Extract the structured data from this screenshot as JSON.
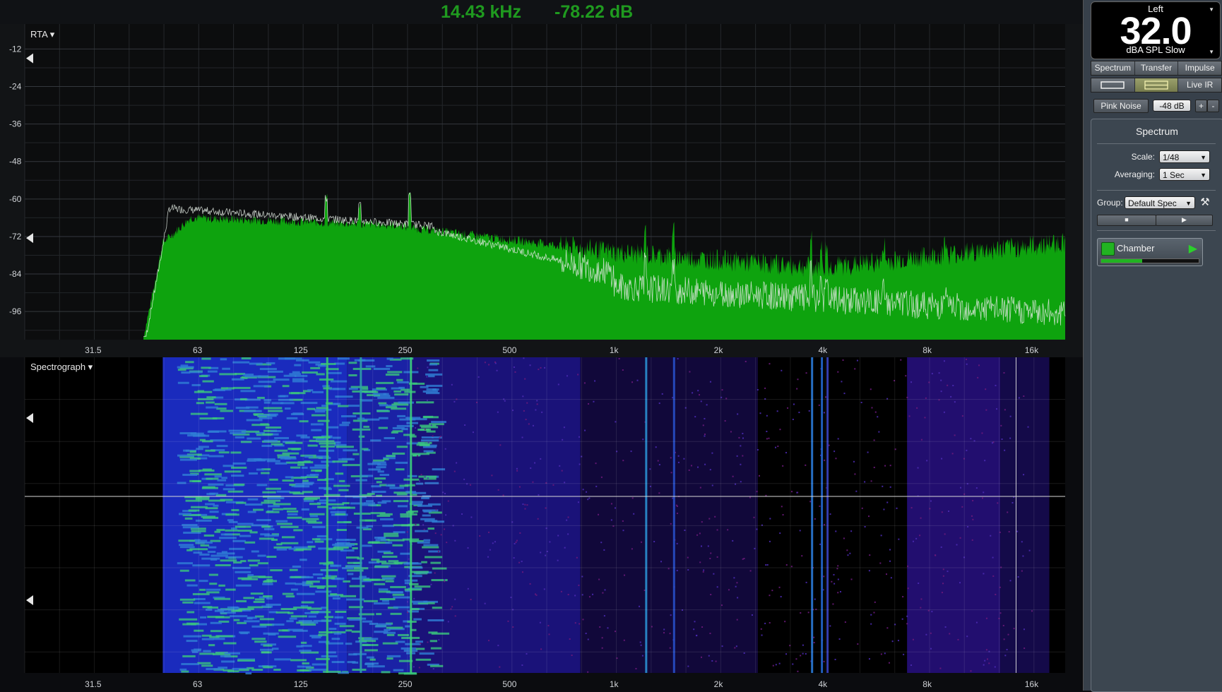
{
  "readout": {
    "frequency": "14.43 kHz",
    "level": "-78.22 dB",
    "color": "#1f9a1f"
  },
  "rta": {
    "menu_label": "RTA ▾",
    "y_ticks": [
      "-12",
      "-24",
      "-36",
      "-48",
      "-60",
      "-72",
      "-84",
      "-96"
    ],
    "x_ticks": [
      "31.5",
      "63",
      "125",
      "250",
      "500",
      "1k",
      "2k",
      "4k",
      "8k",
      "16k"
    ]
  },
  "spectrograph": {
    "menu_label": "Spectrograph ▾",
    "x_ticks": [
      "31.5",
      "63",
      "125",
      "250",
      "500",
      "1k",
      "2k",
      "4k",
      "8k",
      "16k"
    ]
  },
  "meter": {
    "channel": "Left",
    "value": "32.0",
    "unit": "dBA SPL Slow"
  },
  "tabs": [
    "Spectrum",
    "Transfer",
    "Impulse"
  ],
  "live_ir_label": "Live IR",
  "generator": {
    "label": "Pink Noise",
    "level": "-48 dB",
    "plus": "+",
    "minus": "-"
  },
  "spectrum_panel": {
    "title": "Spectrum",
    "scale_label": "Scale:",
    "scale_value": "1/48",
    "averaging_label": "Averaging:",
    "averaging_value": "1 Sec",
    "group_label": "Group:",
    "group_value": "Default Spec"
  },
  "measurement": {
    "name": "Chamber",
    "color": "#25b825"
  },
  "colors": {
    "trace_fill": "#0ea30e",
    "trace_line": "#dfe8df",
    "spectro_low": "#2a1fb0",
    "spectro_high": "#3fd07a"
  }
}
